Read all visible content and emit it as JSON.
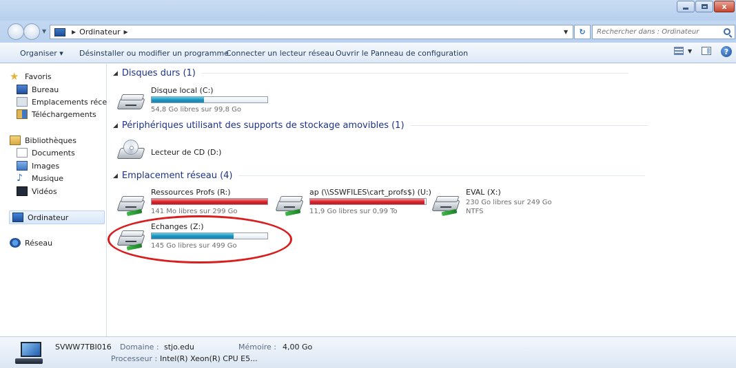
{
  "address": {
    "crumbs": [
      "Ordinateur"
    ],
    "search_placeholder": "Rechercher dans : Ordinateur"
  },
  "toolbar": {
    "organize": "Organiser ▾",
    "uninstall": "Désinstaller ou modifier un programme",
    "map_drive": "Connecter un lecteur réseau",
    "control_panel": "Ouvrir le Panneau de configuration",
    "view_icon": "view-options-icon",
    "pane_icon": "preview-pane-icon",
    "help_icon": "help-icon"
  },
  "nav": {
    "favorites": "Favoris",
    "desktop": "Bureau",
    "recent_places": "Emplacements récer",
    "downloads": "Téléchargements",
    "libraries": "Bibliothèques",
    "documents": "Documents",
    "images": "Images",
    "music": "Musique",
    "videos": "Vidéos",
    "computer": "Ordinateur",
    "network": "Réseau"
  },
  "groups": {
    "hard_disks": "Disques durs (1)",
    "removable": "Périphériques utilisant des supports de stockage amovibles (1)",
    "network": "Emplacement réseau (4)"
  },
  "drives": {
    "c": {
      "name": "Disque local (C:)",
      "free": "54,8 Go libres sur 99,8 Go",
      "used_fraction": 0.45
    },
    "d": {
      "name": "Lecteur de CD (D:)"
    },
    "r": {
      "name": "Ressources Profs (R:)",
      "free": "141 Mo libres sur 299 Go",
      "used_fraction": 0.999
    },
    "u": {
      "name": "ap (\\\\SSWFILES\\cart_profs$) (U:)",
      "free": "11,9 Go libres sur 0,99 To",
      "used_fraction": 0.988
    },
    "x": {
      "name": "EVAL (X:)",
      "free": "230 Go libres sur 249 Go",
      "fs": "NTFS"
    },
    "z": {
      "name": "Echanges (Z:)",
      "free": "145 Go libres sur 499 Go",
      "used_fraction": 0.71
    }
  },
  "colors": {
    "bar_normal": "#1c8fba",
    "bar_full": "#d52029",
    "highlight": "#d81e1e",
    "group_heading": "#1e3287"
  },
  "details": {
    "computer_name": "SVWW7TBI016",
    "domain_label": "Domaine :",
    "domain_value": "stjo.edu",
    "memory_label": "Mémoire :",
    "memory_value": "4,00 Go",
    "cpu_label": "Processeur :",
    "cpu_value": "Intel(R) Xeon(R) CPU E5..."
  }
}
